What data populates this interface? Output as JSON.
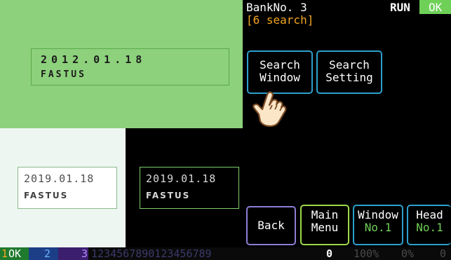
{
  "camera_view": {
    "ocr_line1": "2012.01.18",
    "ocr_line2": "FASTUS"
  },
  "samples": {
    "white": {
      "date": "2019.01.18",
      "name": "FASTUS"
    },
    "black": {
      "date": "2019.01.18",
      "name": "FASTUS"
    }
  },
  "header": {
    "bank_label": "BankNo. 3",
    "run_label": "RUN",
    "ok_label": "OK",
    "search_status": "[6 search]"
  },
  "buttons": {
    "search_window": [
      "Search",
      "Window"
    ],
    "search_setting": [
      "Search",
      "Setting"
    ],
    "back": "Back",
    "main_menu": [
      "Main",
      "Menu"
    ],
    "window": [
      "Window",
      "No.1"
    ],
    "head": [
      "Head",
      "No.1"
    ]
  },
  "status_bar": {
    "ch1_num": "1",
    "ch1_state": "OK",
    "ch2_num": "2",
    "ch3_num": "3",
    "digits": "1234567890123456789",
    "counter": "0",
    "pct1": "100%",
    "pct2": "0%",
    "tail": "0"
  },
  "colors": {
    "view_green": "#8dd17c",
    "ok_green": "#6fd058",
    "status_orange": "#f3a520",
    "button_blue": "#2da0cd"
  },
  "icons": [
    "hand-pointer-icon"
  ]
}
